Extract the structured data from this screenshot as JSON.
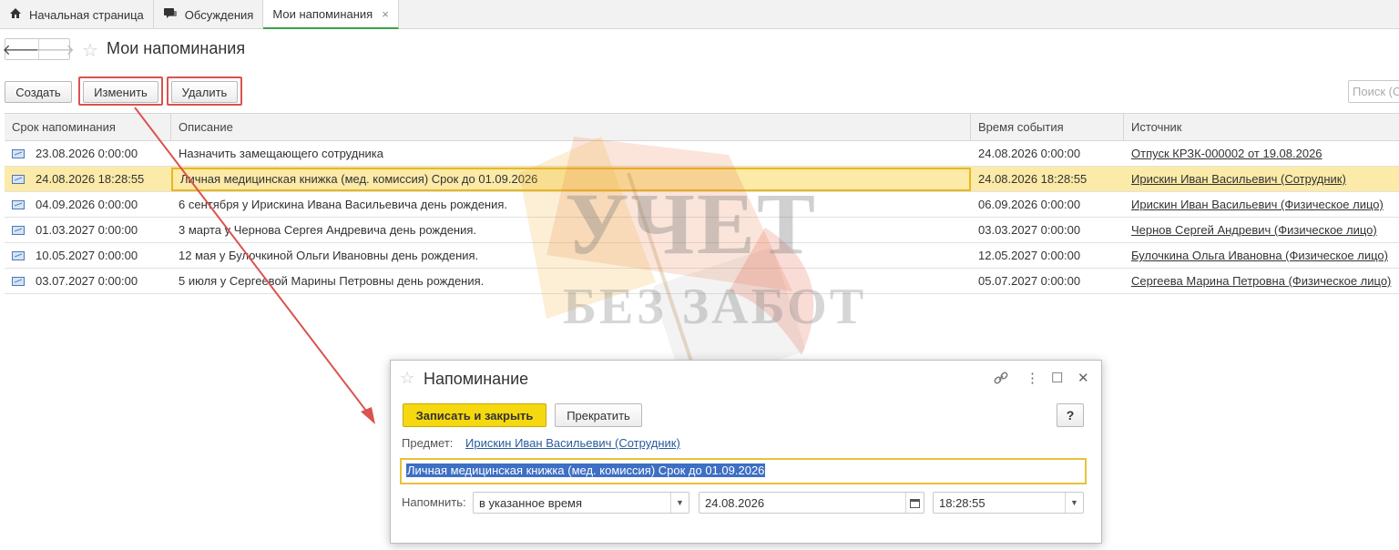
{
  "tabs": [
    {
      "label": "Начальная страница",
      "icon": "home-icon"
    },
    {
      "label": "Обсуждения",
      "icon": "chat-icon"
    },
    {
      "label": "Мои напоминания",
      "icon": "",
      "close": "×"
    }
  ],
  "header": {
    "title": "Мои напоминания"
  },
  "toolbar": {
    "create": "Создать",
    "edit": "Изменить",
    "delete": "Удалить",
    "search_placeholder": "Поиск (Ctrl+F)"
  },
  "table": {
    "columns": [
      "Срок напоминания",
      "Описание",
      "Время события",
      "Источник"
    ],
    "rows": [
      {
        "due": "23.08.2026 0:00:00",
        "desc": "Назначить замещающего сотрудника",
        "event": "24.08.2026 0:00:00",
        "source": "Отпуск КРЗК-000002 от 19.08.2026"
      },
      {
        "due": "24.08.2026 18:28:55",
        "desc": "Личная медицинская книжка (мед. комиссия) Срок до 01.09.2026",
        "event": "24.08.2026 18:28:55",
        "source": "Ирискин Иван Васильевич (Сотрудник)"
      },
      {
        "due": "04.09.2026 0:00:00",
        "desc": "6 сентября у Ирискина Ивана Васильевича день рождения.",
        "event": "06.09.2026 0:00:00",
        "source": "Ирискин Иван Васильевич (Физическое лицо)"
      },
      {
        "due": "01.03.2027 0:00:00",
        "desc": "3 марта у Чернова Сергея Андревича день рождения.",
        "event": "03.03.2027 0:00:00",
        "source": "Чернов Сергей Андревич (Физическое лицо)"
      },
      {
        "due": "10.05.2027 0:00:00",
        "desc": "12 мая у Булочкиной Ольги Ивановны день рождения.",
        "event": "12.05.2027 0:00:00",
        "source": "Булочкина Ольга Ивановна (Физическое лицо)"
      },
      {
        "due": "03.07.2027 0:00:00",
        "desc": "5 июля у Сергеевой Марины Петровны день рождения.",
        "event": "05.07.2027 0:00:00",
        "source": "Сергеева Марина Петровна (Физическое лицо)"
      }
    ],
    "selected_row": 1
  },
  "watermark": {
    "line1": "УЧЕТ",
    "line2": "БЕЗ ЗАБОТ"
  },
  "dialog": {
    "title": "Напоминание",
    "save_close": "Записать и закрыть",
    "stop": "Прекратить",
    "help": "?",
    "subject_label": "Предмет:",
    "subject_value": "Ирискин Иван Васильевич (Сотрудник)",
    "text": "Личная медицинская книжка (мед. комиссия) Срок до 01.09.2026",
    "remind_label": "Напомнить:",
    "remind_mode": "в указанное время",
    "date": "24.08.2026",
    "time": "18:28:55"
  },
  "colors": {
    "accent_tab": "#3aa44b",
    "primary_button": "#f5d80f",
    "selection_row": "#fbeaa8",
    "annotation": "#d9534f"
  }
}
